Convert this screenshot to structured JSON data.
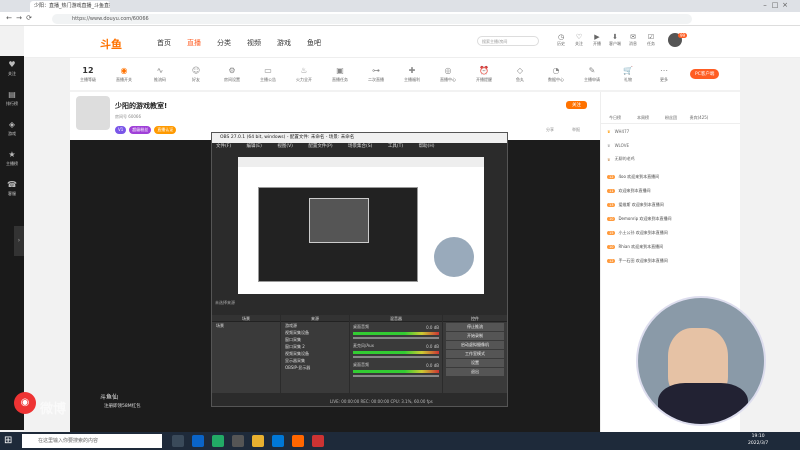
{
  "browser": {
    "tab_title": "少阳：直播_热门游戏直播_斗鱼直播",
    "url": "https://www.douyu.com/60066"
  },
  "site": {
    "logo": "斗鱼",
    "nav": [
      "首页",
      "直播",
      "分类",
      "视频",
      "游戏",
      "鱼吧"
    ],
    "search_placeholder": "搜索主播/房间",
    "header_icons": [
      "历史",
      "关注",
      "开播",
      "客户端",
      "消息",
      "任务"
    ],
    "badge_count": "99",
    "categories": [
      {
        "label": "12\n主播等级",
        "icon": "level-icon"
      },
      {
        "label": "直播开关",
        "icon": "switch-icon"
      },
      {
        "label": "推流码",
        "icon": "wave-icon"
      },
      {
        "label": "好友",
        "icon": "friends-icon"
      },
      {
        "label": "房间设置",
        "icon": "settings-icon"
      },
      {
        "label": "主播公告",
        "icon": "notice-icon"
      },
      {
        "label": "火力全开",
        "icon": "fire-icon"
      },
      {
        "label": "直播任务",
        "icon": "task-icon"
      },
      {
        "label": "二次直播",
        "icon": "toggle-icon"
      },
      {
        "label": "主播福利",
        "icon": "gift-icon"
      },
      {
        "label": "直播中心",
        "icon": "center-icon"
      },
      {
        "label": "开播提醒",
        "icon": "alarm-icon"
      },
      {
        "label": "鱼丸",
        "icon": "diamond-icon"
      },
      {
        "label": "数据中心",
        "icon": "data-icon"
      },
      {
        "label": "主播申请",
        "icon": "apply-icon"
      },
      {
        "label": "礼物",
        "icon": "cart-icon"
      },
      {
        "label": "更多",
        "icon": "more-icon"
      }
    ],
    "pc_btn": "PC客户端"
  },
  "left_sidebar": [
    "关注",
    "排行榜",
    "游戏",
    "主播榜",
    "客服"
  ],
  "room": {
    "title": "少阳的游戏教室!",
    "tags": [
      "V1",
      "超级粉丝",
      "直播认证"
    ],
    "id_text": "房间号 60066",
    "follow_btn": "关注",
    "share": "分享",
    "report": "举报"
  },
  "obs": {
    "title": "OBS 27.0.1 (64 bit, windows) - 配置文件: 未命名 - 场景: 未命名",
    "menu": [
      "文件(F)",
      "编辑(E)",
      "视图(V)",
      "配置文件(P)",
      "场景集合(S)",
      "工具(T)",
      "帮助(H)"
    ],
    "docks": {
      "scenes": "场景",
      "sources": "来源",
      "mixer": "混音器",
      "controls": "控件"
    },
    "scene_item": "场景",
    "sources": [
      "游戏源",
      "视频采集设备",
      "窗口采集",
      "窗口采集 2",
      "视频采集设备",
      "显示器采集",
      "OBSIP-显示器"
    ],
    "mixer": [
      {
        "name": "桌面音频",
        "db": "0.0 dB"
      },
      {
        "name": "麦克风/Aux",
        "db": "0.0 dB"
      },
      {
        "name": "桌面音频",
        "db": "0.0 dB"
      }
    ],
    "controls": [
      "停止推流",
      "开始录制",
      "启动虚拟摄像机",
      "工作室模式",
      "设置",
      "退出"
    ],
    "status": "LIVE: 00:00:00   REC: 00:00:00   CPU: 3.1%, 60.00 fps"
  },
  "right_panel": {
    "tabs": [
      "今日榜",
      "本周榜",
      "粉丝团",
      "贵宾(425)"
    ],
    "ranks": [
      "WH477",
      "WLOVE",
      "无聊的老鸡"
    ],
    "chats": [
      {
        "lvl": "12",
        "text": "4oo 欢迎来到本直播间"
      },
      {
        "lvl": "11",
        "text": "欢迎来到本直播间"
      },
      {
        "lvl": "13",
        "text": "爱维斯 欢迎来到本直播间"
      },
      {
        "lvl": "10",
        "text": "Demonrip 欢迎来到本直播间"
      },
      {
        "lvl": "15",
        "text": "小土公孙 欢迎来到本直播间"
      },
      {
        "lvl": "10",
        "text": "Rhian 欢迎来到本直播间"
      },
      {
        "lvl": "12",
        "text": "手一石田 欢迎来到本直播间"
      }
    ]
  },
  "watermark": {
    "brand": "微博",
    "dy_name": "斗鱼仙",
    "dy_sub": "注册即领58M红包"
  },
  "taskbar": {
    "search": "在这里输入你要搜索的内容",
    "time": "19:10",
    "date": "2022/3/7"
  },
  "colors": {
    "brand": "#ff7200",
    "accent": "#ff5d23"
  }
}
